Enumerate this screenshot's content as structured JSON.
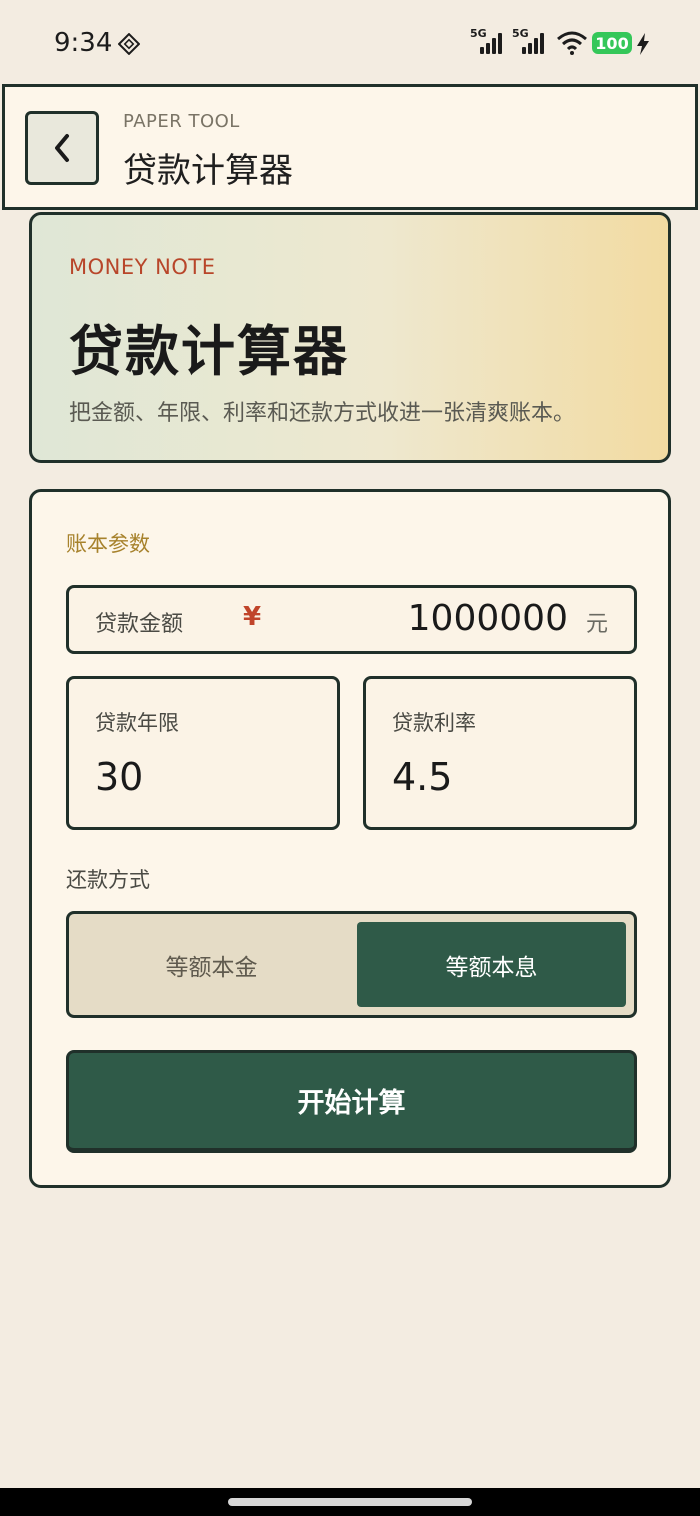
{
  "status_bar": {
    "time": "9:34",
    "network_1": "5G",
    "network_2": "5G",
    "battery_level": "100",
    "icons": [
      "dnd-icon",
      "signal-icon",
      "wifi-icon",
      "battery-icon",
      "charging-bolt-icon"
    ]
  },
  "header": {
    "back_icon": "chevron-left-icon",
    "subtitle": "PAPER TOOL",
    "title": "贷款计算器"
  },
  "hero": {
    "tag": "MONEY NOTE",
    "title": "贷款计算器",
    "description": "把金额、年限、利率和还款方式收进一张清爽账本。"
  },
  "form": {
    "section_label": "账本参数",
    "amount": {
      "label": "贷款金额",
      "currency_symbol": "¥",
      "value": "1000000",
      "unit": "元"
    },
    "years": {
      "label": "贷款年限",
      "value": "30"
    },
    "rate": {
      "label": "贷款利率",
      "value": "4.5"
    },
    "method": {
      "label": "还款方式",
      "options": [
        "等额本金",
        "等额本息"
      ],
      "selected": "等额本息"
    },
    "submit_label": "开始计算"
  },
  "colors": {
    "accent_green": "#2f5a48",
    "border_dark": "#20302a",
    "tag_red": "#b8462a",
    "label_gold": "#a7822c",
    "paper": "#fdf6ea"
  }
}
